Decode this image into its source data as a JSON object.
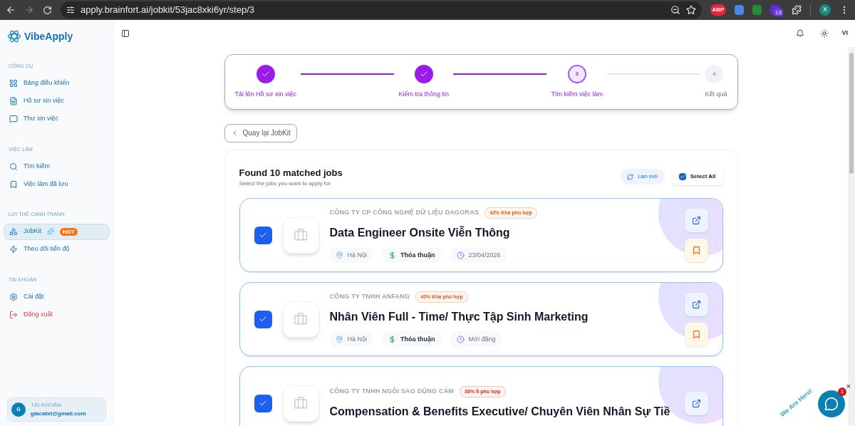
{
  "browser": {
    "url": "apply.brainfort.ai/jobkit/53jac8xki6yr/step/3",
    "extensions": [
      {
        "label": "ABP"
      },
      {
        "label": "13"
      }
    ],
    "profile": "X"
  },
  "brand": "VibeApply",
  "sidebar": {
    "sections": [
      {
        "title": "CÔNG CỤ",
        "items": [
          {
            "label": "Bảng điều khiển",
            "selected": false
          },
          {
            "label": "Hồ sơ xin việc",
            "selected": false
          },
          {
            "label": "Thư xin việc",
            "selected": false
          }
        ]
      },
      {
        "title": "VIỆC LÀM",
        "items": [
          {
            "label": "Tìm kiếm",
            "selected": false
          },
          {
            "label": "Việc làm đã lưu",
            "selected": false
          }
        ]
      },
      {
        "title": "LỢI THẾ CẠNH TRANH",
        "items": [
          {
            "label": "JobKit",
            "selected": true,
            "badge": "HOT"
          },
          {
            "label": "Theo dõi tiến độ",
            "selected": false
          }
        ]
      },
      {
        "title": "TÀI KHOẢN",
        "items": [
          {
            "label": "Cài đặt",
            "selected": false
          },
          {
            "label": "Đăng xuất",
            "selected": false,
            "kind": "danger"
          }
        ]
      }
    ],
    "account": {
      "avatar": "G",
      "title": "TÀI KHOẢN",
      "email": "giacatxt@gmail.com"
    }
  },
  "header": {
    "language": "VI"
  },
  "stepper": [
    {
      "label": "Tải lên Hồ sơ xin việc",
      "completed": true,
      "selected": false
    },
    {
      "label": "Kiểm tra thông tin",
      "completed": true,
      "selected": false
    },
    {
      "label": "Tìm kiếm việc làm",
      "completed": false,
      "selected": true,
      "number": "3"
    },
    {
      "label": "Kết quả",
      "completed": false,
      "selected": false,
      "number": "4"
    }
  ],
  "back_button": "Quay lại JobKit",
  "results": {
    "title": "Found 10 matched jobs",
    "subtitle": "Select the jobs you want to apply for",
    "refresh": "Làm mới",
    "select_all": {
      "label": "Select All",
      "checked": true
    }
  },
  "jobs": [
    {
      "checked": true,
      "company": "CÔNG TY CP CÔNG NGHỆ DỮ LIỆU DAGORAS",
      "match": "42% Khá phù hợp",
      "color": "#ea580c",
      "title": "Data Engineer Onsite Viễn Thông",
      "location": "Hà Nội",
      "salary": "Thỏa thuận",
      "posted": "23/04/2026"
    },
    {
      "checked": true,
      "company": "CÔNG TY TNHH ANFANG",
      "match": "40% Khá phù hợp",
      "color": "#ea580c",
      "title": "Nhân Viên Full - Time/ Thực Tập Sinh Marketing",
      "location": "Hà Nội",
      "salary": "Thỏa thuận",
      "posted": "Mới đăng"
    },
    {
      "checked": true,
      "company": "CÔNG TY TNHH NGÔI SAO DŨNG CẢM",
      "match": "38% Ít phù hợp",
      "color": "#dc2626",
      "title": "Compensation & Benefits Executive/ Chuyên Viên Nhân Sự Tiề"
    }
  ],
  "chat_widget": {
    "caption": "We Are Here!",
    "badge": "1",
    "close": "×"
  }
}
